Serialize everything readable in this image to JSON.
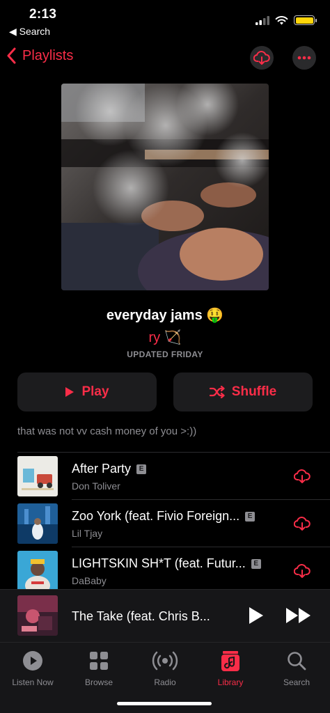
{
  "status": {
    "time": "2:13",
    "back_label": "◀ Search"
  },
  "nav": {
    "back_label": "Playlists"
  },
  "playlist": {
    "title": "everyday jams 🤑",
    "curator": "ry 🏹",
    "updated": "UPDATED FRIDAY",
    "description": "that was not vv cash money of you >:))"
  },
  "actions": {
    "play_label": "Play",
    "shuffle_label": "Shuffle"
  },
  "tracks": [
    {
      "title": "After Party",
      "artist": "Don Toliver",
      "explicit": "E"
    },
    {
      "title": "Zoo York (feat. Fivio Foreign...",
      "artist": "Lil Tjay",
      "explicit": "E"
    },
    {
      "title": "LIGHTSKIN SH*T (feat. Futur...",
      "artist": "DaBaby",
      "explicit": "E"
    }
  ],
  "now_playing": {
    "title": "The Take (feat. Chris B..."
  },
  "tabs": [
    {
      "label": "Listen Now",
      "icon": "play-circle-icon"
    },
    {
      "label": "Browse",
      "icon": "grid-icon"
    },
    {
      "label": "Radio",
      "icon": "radio-waves-icon"
    },
    {
      "label": "Library",
      "icon": "music-note-icon"
    },
    {
      "label": "Search",
      "icon": "magnifier-icon"
    }
  ],
  "colors": {
    "accent": "#fa2d48",
    "background": "#000000",
    "secondary_text": "#8e8e93",
    "button_bg": "#1c1c1e"
  }
}
